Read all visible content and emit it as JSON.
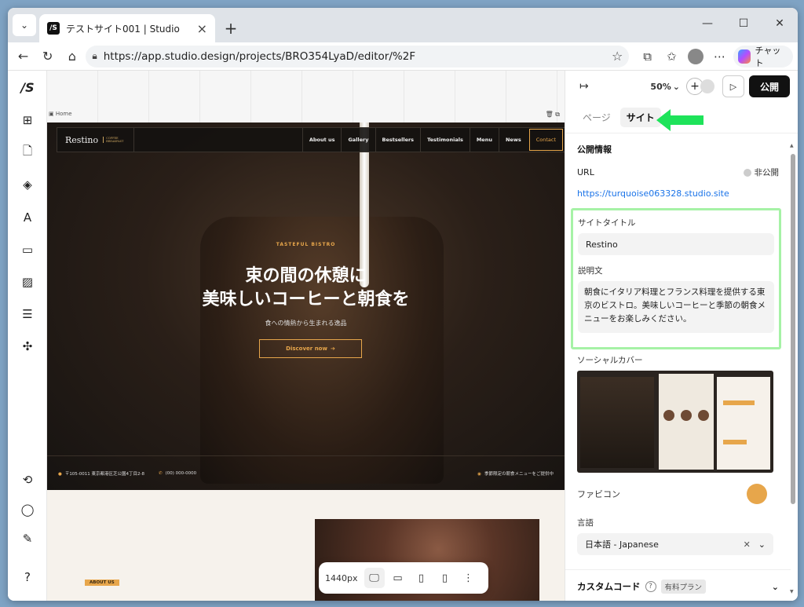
{
  "browser": {
    "tab_title": "テストサイト001 | Studio",
    "url": "https://app.studio.design/projects/BRO354LyaD/editor/%2F",
    "copilot_label": "チャット"
  },
  "canvas": {
    "frame_label": "Home",
    "site": {
      "brand": "Restino",
      "brand_sub": "COFFEE BREAKFAST",
      "nav": [
        "About us",
        "Gallery",
        "Bestsellers",
        "Testimonials",
        "Menu",
        "News"
      ],
      "nav_contact": "Contact",
      "eyebrow": "TASTEFUL BISTRO",
      "title_line1": "束の間の休憩に",
      "title_line2": "美味しいコーヒーと朝食を",
      "subtitle": "食への情熱から生まれる逸品",
      "cta": "Discover now",
      "address": "〒105-0011 東京都港区芝公園4丁目2-8",
      "phone": "(00) 000-0000",
      "notice": "季節限定の朝食メニューをご提供中",
      "about_tag": "ABOUT US"
    },
    "device_bar": {
      "width_label": "1440px"
    }
  },
  "panel": {
    "zoom": "50%",
    "publish_label": "公開",
    "tabs": [
      "ページ",
      "サイト"
    ],
    "active_tab": "サイト",
    "section_title": "公開情報",
    "url_label": "URL",
    "status": "非公開",
    "site_url": "https://turquoise063328.studio.site",
    "site_title_label": "サイトタイトル",
    "site_title_value": "Restino",
    "description_label": "説明文",
    "description_value": "朝食にイタリア料理とフランス料理を提供する東京のビストロ。美味しいコーヒーと季節の朝食メニューをお楽しみください。",
    "social_cover_label": "ソーシャルカバー",
    "favicon_label": "ファビコン",
    "language_label": "言語",
    "language_value": "日本語 - Japanese",
    "custom_code_label": "カスタムコード",
    "paid_badge": "有料プラン"
  },
  "colors": {
    "accent": "#e7a64b",
    "highlight": "#a6f2a6",
    "publish_bg": "#111111",
    "link": "#1a73e8"
  }
}
